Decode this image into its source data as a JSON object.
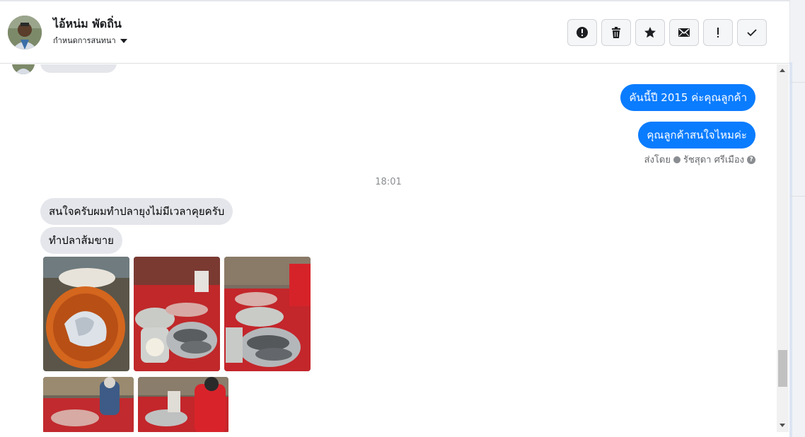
{
  "header": {
    "name": "ไอ้หน่ม พัดถิ่น",
    "subtitle": "กำหนดการสนทนา"
  },
  "actions": [
    {
      "icon": "alert-circle-icon"
    },
    {
      "icon": "trash-icon"
    },
    {
      "icon": "star-icon"
    },
    {
      "icon": "envelope-icon"
    },
    {
      "icon": "exclamation-icon"
    },
    {
      "icon": "check-icon"
    }
  ],
  "messages": {
    "out_1": "คันนี้ปี 2015 ค่ะคุณลูกค้า",
    "out_2": "คุณลูกค้าสนใจไหมค่ะ",
    "sent_by_label": "ส่งโดย",
    "sent_by_name": "รัชสุดา ศรีเมือง",
    "timestamp": "18:01",
    "in_1": "สนใจครับผมทำปลายุงไม่มีเวลาคุยครับ",
    "in_2": "ทำปลาส้มขาย"
  },
  "colors": {
    "outgoing_bubble": "#0a7cff",
    "incoming_bubble": "#e4e6eb"
  }
}
